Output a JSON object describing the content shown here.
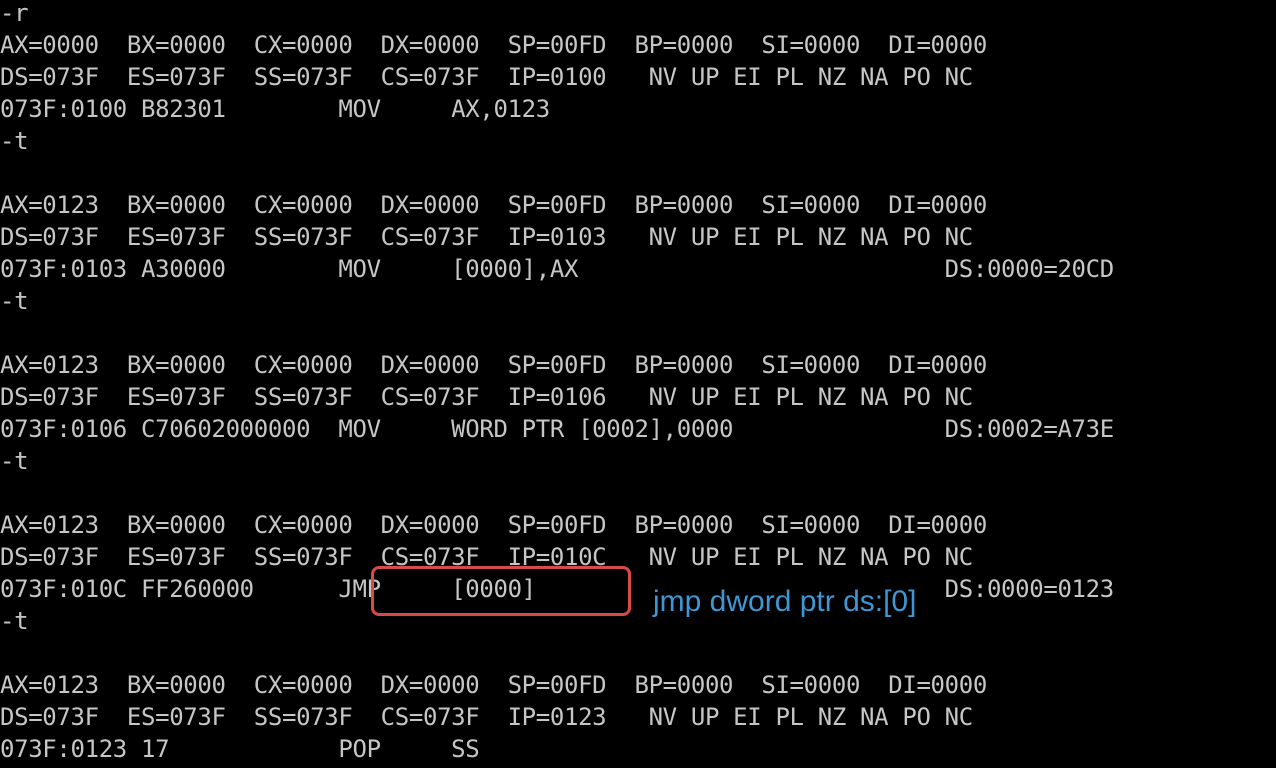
{
  "terminal": {
    "lines": [
      "-r",
      "AX=0000  BX=0000  CX=0000  DX=0000  SP=00FD  BP=0000  SI=0000  DI=0000",
      "DS=073F  ES=073F  SS=073F  CS=073F  IP=0100   NV UP EI PL NZ NA PO NC",
      "073F:0100 B82301        MOV     AX,0123",
      "-t",
      "",
      "AX=0123  BX=0000  CX=0000  DX=0000  SP=00FD  BP=0000  SI=0000  DI=0000",
      "DS=073F  ES=073F  SS=073F  CS=073F  IP=0103   NV UP EI PL NZ NA PO NC",
      "073F:0103 A30000        MOV     [0000],AX                          DS:0000=20CD",
      "-t",
      "",
      "AX=0123  BX=0000  CX=0000  DX=0000  SP=00FD  BP=0000  SI=0000  DI=0000",
      "DS=073F  ES=073F  SS=073F  CS=073F  IP=0106   NV UP EI PL NZ NA PO NC",
      "073F:0106 C70602000000  MOV     WORD PTR [0002],0000               DS:0002=A73E",
      "-t",
      "",
      "AX=0123  BX=0000  CX=0000  DX=0000  SP=00FD  BP=0000  SI=0000  DI=0000",
      "DS=073F  ES=073F  SS=073F  CS=073F  IP=010C   NV UP EI PL NZ NA PO NC",
      "073F:010C FF260000      JMP     [0000]                             DS:0000=0123",
      "-t",
      "",
      "AX=0123  BX=0000  CX=0000  DX=0000  SP=00FD  BP=0000  SI=0000  DI=0000",
      "DS=073F  ES=073F  SS=073F  CS=073F  IP=0123   NV UP EI PL NZ NA PO NC",
      "073F:0123 17            POP     SS"
    ]
  },
  "annotation": {
    "text": "jmp dword ptr ds:[0]",
    "color": "#3f96d2"
  },
  "colors": {
    "background": "#000000",
    "terminal_text": "#c6c6c6",
    "highlight_border": "#d94b4b"
  }
}
